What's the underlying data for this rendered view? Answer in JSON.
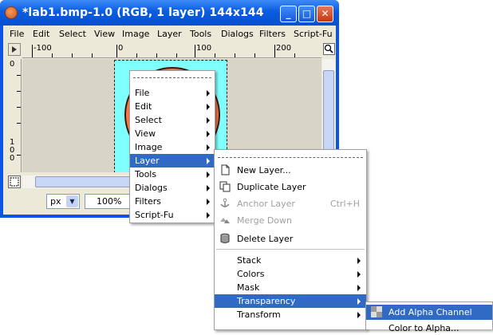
{
  "window": {
    "title": "*lab1.bmp-1.0 (RGB, 1 layer) 144x144",
    "minimize": "_",
    "maximize": "□",
    "close": "✕"
  },
  "menubar": [
    "File",
    "Edit",
    "Select",
    "View",
    "Image",
    "Layer",
    "Tools",
    "Dialogs",
    "Filters",
    "Script-Fu"
  ],
  "ruler": {
    "h_labels": [
      "-100",
      "0",
      "100",
      "200"
    ],
    "v_labels": [
      "0",
      "1\n0\n0"
    ]
  },
  "status": {
    "unit": "px",
    "zoom": "100%"
  },
  "image_menu": {
    "items": [
      "File",
      "Edit",
      "Select",
      "View",
      "Image",
      "Layer",
      "Tools",
      "Dialogs",
      "Filters",
      "Script-Fu"
    ],
    "highlighted": "Layer"
  },
  "layer_menu": {
    "new_layer": "New Layer...",
    "duplicate_layer": "Duplicate Layer",
    "anchor_layer": "Anchor Layer",
    "anchor_accel": "Ctrl+H",
    "merge_down": "Merge Down",
    "delete_layer": "Delete Layer",
    "stack": "Stack",
    "colors": "Colors",
    "mask": "Mask",
    "transparency": "Transparency",
    "transform": "Transform"
  },
  "transparency_menu": {
    "add_alpha_channel": "Add Alpha Channel",
    "color_to_alpha": "Color to Alpha..."
  },
  "colors": {
    "titlebar": "#0a5ce0",
    "highlight": "#316ac5",
    "canvas_bg": "#80ffff",
    "circle": "#f0784a"
  },
  "icons": [
    "gimp-app-icon",
    "minimize-icon",
    "maximize-icon",
    "close-icon",
    "ruler-menu-icon",
    "navigate-icon",
    "quickmask-icon",
    "new-layer-icon",
    "duplicate-layer-icon",
    "anchor-icon",
    "merge-down-icon",
    "delete-layer-icon",
    "alpha-channel-icon"
  ]
}
